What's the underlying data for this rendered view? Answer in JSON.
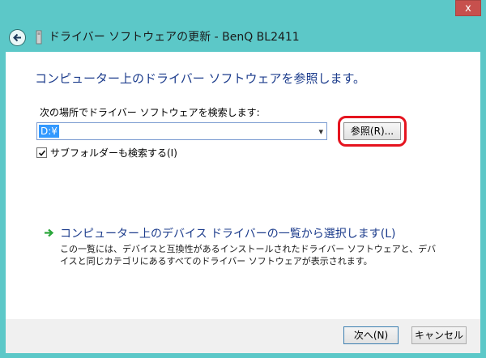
{
  "window": {
    "title": "ドライバー ソフトウェアの更新 - BenQ BL2411",
    "close_label": "x"
  },
  "content": {
    "heading": "コンピューター上のドライバー ソフトウェアを参照します。",
    "search_label": "次の場所でドライバー ソフトウェアを検索します:",
    "path_value": "D:¥",
    "browse_label": "参照(R)...",
    "subfolder_label": "サブフォルダーも検索する(I)",
    "subfolder_checked": true,
    "pick_title": "コンピューター上のデバイス ドライバーの一覧から選択します(L)",
    "pick_description": "この一覧には、デバイスと互換性があるインストールされたドライバー ソフトウェアと、デバイスと同じカテゴリにあるすべてのドライバー ソフトウェアが表示されます。"
  },
  "footer": {
    "next_label": "次へ(N)",
    "cancel_label": "キャンセル"
  },
  "colors": {
    "frame": "#5cc8c8",
    "heading_blue": "#1c3c8c",
    "highlight_red": "#e5141f",
    "selection_blue": "#3399ff",
    "arrow_green": "#2aa63a"
  }
}
